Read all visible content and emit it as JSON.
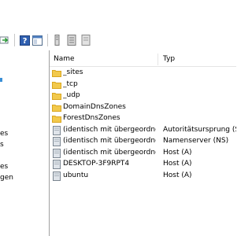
{
  "tree": {
    "fragments": [
      "es",
      "s",
      "es",
      "gen"
    ]
  },
  "list": {
    "columns": {
      "name": "Name",
      "type": "Typ"
    },
    "rows": [
      {
        "name": "_sites",
        "type": "",
        "icon": "folder-icon"
      },
      {
        "name": "_tcp",
        "type": "",
        "icon": "folder-icon"
      },
      {
        "name": "_udp",
        "type": "",
        "icon": "folder-icon"
      },
      {
        "name": "DomainDnsZones",
        "type": "",
        "icon": "folder-icon"
      },
      {
        "name": "ForestDnsZones",
        "type": "",
        "icon": "folder-icon"
      },
      {
        "name": "(identisch mit übergeordne...",
        "type": "Autoritätsursprung (SO",
        "icon": "record-icon"
      },
      {
        "name": "(identisch mit übergeordne...",
        "type": "Namenserver (NS)",
        "icon": "record-icon"
      },
      {
        "name": "(identisch mit übergeordne...",
        "type": "Host (A)",
        "icon": "record-icon"
      },
      {
        "name": "DESKTOP-3F9RPT4",
        "type": "Host (A)",
        "icon": "record-icon"
      },
      {
        "name": "ubuntu",
        "type": "Host (A)",
        "icon": "record-icon"
      }
    ]
  },
  "colors": {
    "folder": "#f2c94c",
    "folder_dark": "#d9a620",
    "record": "#dfe4ea",
    "record_border": "#7a8590",
    "accent": "#0a64b4"
  }
}
